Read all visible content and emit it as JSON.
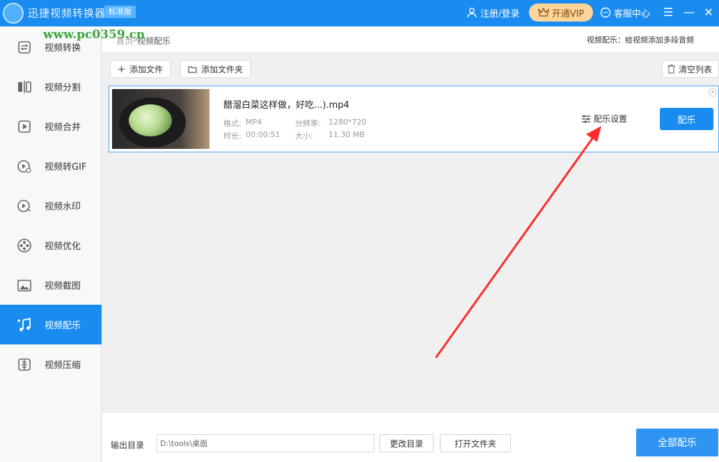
{
  "titlebar": {
    "app_title": "迅捷视频转换器",
    "version": "标准版",
    "login": "注册/登录",
    "vip": "开通VIP",
    "service": "客服中心"
  },
  "watermark": "www.pc0359.cn",
  "sidebar": {
    "items": [
      {
        "label": "视频转换",
        "icon": "convert-icon"
      },
      {
        "label": "视频分割",
        "icon": "split-icon"
      },
      {
        "label": "视频合并",
        "icon": "merge-icon"
      },
      {
        "label": "视频转GIF",
        "icon": "gif-icon"
      },
      {
        "label": "视频水印",
        "icon": "watermark-icon"
      },
      {
        "label": "视频优化",
        "icon": "optimize-icon"
      },
      {
        "label": "视频截图",
        "icon": "screenshot-icon"
      },
      {
        "label": "视频配乐",
        "icon": "music-icon"
      },
      {
        "label": "视频压缩",
        "icon": "compress-icon"
      }
    ],
    "active_index": 7
  },
  "breadcrumb": {
    "home": "首页",
    "separator": ">",
    "current": "视频配乐",
    "description": "视频配乐：给视频添加多段音频"
  },
  "toolbar": {
    "add_file": "添加文件",
    "add_folder": "添加文件夹",
    "clear_list": "清空列表"
  },
  "file": {
    "name": "醋溜白菜这样做，好吃...).mp4",
    "format_label": "格式:",
    "format": "MP4",
    "resolution_label": "分辨率:",
    "resolution": "1280*720",
    "duration_label": "时长:",
    "duration": "00:00:51",
    "size_label": "大小:",
    "size": "11.30 MB",
    "settings_label": "配乐设置",
    "action_label": "配乐"
  },
  "footer": {
    "output_label": "输出目录",
    "output_path": "D:\\tools\\桌面",
    "change_dir": "更改目录",
    "open_folder": "打开文件夹",
    "all_action": "全部配乐"
  },
  "colors": {
    "primary": "#1a8cf0",
    "vip": "#fbd59a",
    "arrow": "#ff2b2b"
  }
}
